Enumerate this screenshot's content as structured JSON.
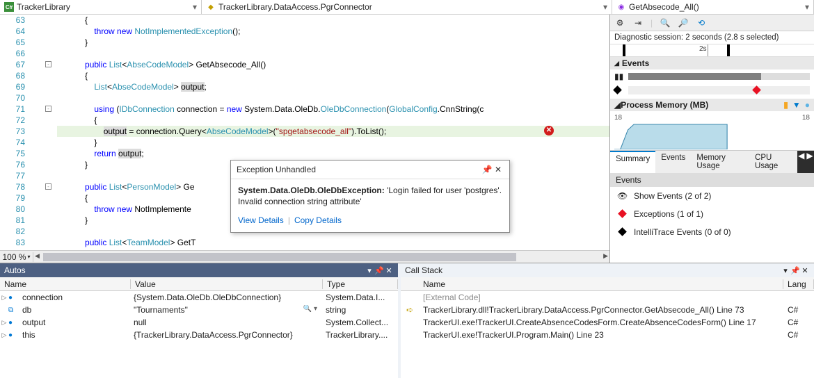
{
  "breadcrumb": {
    "project": "TrackerLibrary",
    "class": "TrackerLibrary.DataAccess.PgrConnector",
    "method": "GetAbsecode_All()"
  },
  "editor": {
    "zoom": "100 %",
    "lines": [
      {
        "n": 63,
        "fold": "",
        "t": "            {"
      },
      {
        "n": 64,
        "fold": "",
        "t": "                throw new NotImplementedException();",
        "tokens": [
          [
            "                ",
            ""
          ],
          [
            "throw",
            "kw"
          ],
          [
            " ",
            ""
          ],
          [
            "new",
            "kw"
          ],
          [
            " ",
            ""
          ],
          [
            "NotImplementedException",
            "type"
          ],
          [
            "();",
            ""
          ]
        ]
      },
      {
        "n": 65,
        "fold": "",
        "t": "            }"
      },
      {
        "n": 66,
        "fold": "",
        "t": ""
      },
      {
        "n": 67,
        "fold": "-",
        "t": "            public List<AbseCodeModel> GetAbsecode_All()",
        "tokens": [
          [
            "            ",
            ""
          ],
          [
            "public",
            "kw"
          ],
          [
            " ",
            ""
          ],
          [
            "List",
            "type"
          ],
          [
            "<",
            ""
          ],
          [
            "AbseCodeModel",
            "type"
          ],
          [
            "> GetAbsecode_All()",
            ""
          ]
        ]
      },
      {
        "n": 68,
        "fold": "",
        "t": "            {"
      },
      {
        "n": 69,
        "fold": "",
        "t": "                List<AbseCodeModel> output;",
        "tokens": [
          [
            "                ",
            ""
          ],
          [
            "List",
            "type"
          ],
          [
            "<",
            ""
          ],
          [
            "AbseCodeModel",
            "type"
          ],
          [
            "> ",
            ""
          ],
          [
            "output",
            "hl-var"
          ],
          [
            ";",
            ""
          ]
        ]
      },
      {
        "n": 70,
        "fold": "",
        "t": ""
      },
      {
        "n": 71,
        "fold": "-",
        "t": "                using (IDbConnection connection = new System.Data.OleDb.OleDbConnection(GlobalConfig.CnnString(c",
        "tokens": [
          [
            "                ",
            ""
          ],
          [
            "using",
            "kw"
          ],
          [
            " (",
            ""
          ],
          [
            "IDbConnection",
            "type"
          ],
          [
            " connection = ",
            ""
          ],
          [
            "new",
            "kw"
          ],
          [
            " System.Data.OleDb.",
            ""
          ],
          [
            "OleDbConnection",
            "type"
          ],
          [
            "(",
            ""
          ],
          [
            "GlobalConfig",
            "type"
          ],
          [
            ".CnnString(c",
            ""
          ]
        ],
        "leftGlyph": "arrow"
      },
      {
        "n": 72,
        "fold": "",
        "t": "                {"
      },
      {
        "n": 73,
        "fold": "",
        "t": "                    output = connection.Query<AbseCodeModel>(\"spgetabsecode_all\").ToList();",
        "hl": true,
        "err": true,
        "tokens": [
          [
            "                    ",
            ""
          ],
          [
            "output",
            "hl-var"
          ],
          [
            " = connection.Query<",
            ""
          ],
          [
            "AbseCodeModel",
            "type"
          ],
          [
            ">(",
            ""
          ],
          [
            "\"spgetabsecode_all\"",
            "str"
          ],
          [
            ").ToList();",
            ""
          ]
        ]
      },
      {
        "n": 74,
        "fold": "",
        "t": "                }"
      },
      {
        "n": 75,
        "fold": "",
        "t": "                return output;",
        "tokens": [
          [
            "                ",
            ""
          ],
          [
            "return",
            "kw"
          ],
          [
            " ",
            ""
          ],
          [
            "output",
            "hl-var"
          ],
          [
            ";",
            ""
          ]
        ]
      },
      {
        "n": 76,
        "fold": "",
        "t": "            }"
      },
      {
        "n": 77,
        "fold": "",
        "t": ""
      },
      {
        "n": 78,
        "fold": "-",
        "t": "            public List<PersonModel> Ge",
        "tokens": [
          [
            "            ",
            ""
          ],
          [
            "public",
            "kw"
          ],
          [
            " ",
            ""
          ],
          [
            "List",
            "type"
          ],
          [
            "<",
            ""
          ],
          [
            "PersonModel",
            "type"
          ],
          [
            "> Ge",
            ""
          ]
        ]
      },
      {
        "n": 79,
        "fold": "",
        "t": "            {"
      },
      {
        "n": 80,
        "fold": "",
        "t": "                throw new NotImplemente",
        "tokens": [
          [
            "                ",
            ""
          ],
          [
            "throw",
            "kw"
          ],
          [
            " ",
            ""
          ],
          [
            "new",
            "kw"
          ],
          [
            " NotImplemente",
            ""
          ]
        ]
      },
      {
        "n": 81,
        "fold": "",
        "t": "            }"
      },
      {
        "n": 82,
        "fold": "",
        "t": ""
      },
      {
        "n": 83,
        "fold": "",
        "t": "            public List<TeamModel> GetT",
        "tokens": [
          [
            "            ",
            ""
          ],
          [
            "public",
            "kw"
          ],
          [
            " ",
            ""
          ],
          [
            "List",
            "type"
          ],
          [
            "<",
            ""
          ],
          [
            "TeamModel",
            "type"
          ],
          [
            "> GetT",
            ""
          ]
        ]
      }
    ]
  },
  "exception": {
    "title": "Exception Unhandled",
    "type": "System.Data.OleDb.OleDbException:",
    "message": "'Login failed for user 'postgres'. Invalid connection string attribute'",
    "view_details": "View Details",
    "copy_details": "Copy Details"
  },
  "diagnostics": {
    "session": "Diagnostic session: 2 seconds (2.8 s selected)",
    "ruler_label": "2s",
    "events_head": "Events",
    "memory_head": "Process Memory (MB)",
    "memory_y": "18",
    "memory_y_right": "18",
    "tabs": [
      "Summary",
      "Events",
      "Memory Usage",
      "CPU Usage"
    ],
    "events_sub": "Events",
    "event_rows": [
      {
        "icon": "eye",
        "label": "Show Events (2 of 2)"
      },
      {
        "icon": "red-diamond",
        "label": "Exceptions (1 of 1)"
      },
      {
        "icon": "black-diamond",
        "label": "IntelliTrace Events (0 of 0)"
      }
    ],
    "memory_usage_cut": "Memory Usage"
  },
  "autos": {
    "title": "Autos",
    "cols": {
      "name": "Name",
      "value": "Value",
      "type": "Type"
    },
    "rows": [
      {
        "exp": "▷",
        "ico": "●",
        "name": "connection",
        "value": "{System.Data.OleDb.OleDbConnection}",
        "type": "System.Data.I..."
      },
      {
        "exp": "",
        "ico": "⧉",
        "name": "db",
        "value": "\"Tournaments\"",
        "type": "string",
        "val_extra": "🔍 ▾"
      },
      {
        "exp": "▷",
        "ico": "●",
        "name": "output",
        "value": "null",
        "type": "System.Collect..."
      },
      {
        "exp": "▷",
        "ico": "●",
        "name": "this",
        "value": "{TrackerLibrary.DataAccess.PgrConnector}",
        "type": "TrackerLibrary...."
      }
    ]
  },
  "callstack": {
    "title": "Call Stack",
    "cols": {
      "name": "Name",
      "lang": "Lang"
    },
    "rows": [
      {
        "glyph": "",
        "name": "[External Code]",
        "lang": "",
        "dim": true
      },
      {
        "glyph": "➪",
        "name": "TrackerLibrary.dll!TrackerLibrary.DataAccess.PgrConnector.GetAbsecode_All() Line 73",
        "lang": "C#"
      },
      {
        "glyph": "",
        "name": "TrackerUI.exe!TrackerUI.CreateAbsenceCodesForm.CreateAbsenceCodesForm() Line 17",
        "lang": "C#"
      },
      {
        "glyph": "",
        "name": "TrackerUI.exe!TrackerUI.Program.Main() Line 23",
        "lang": "C#"
      }
    ]
  },
  "chart_data": {
    "type": "area",
    "title": "Process Memory (MB)",
    "ylabel": "MB",
    "ylim": [
      0,
      18
    ],
    "x_range_seconds": [
      0,
      2.8
    ],
    "series": [
      {
        "name": "Process Memory",
        "x": [
          0,
          0.2,
          0.35,
          0.5,
          2.8
        ],
        "values": [
          0,
          10,
          16,
          18,
          18
        ]
      }
    ]
  }
}
